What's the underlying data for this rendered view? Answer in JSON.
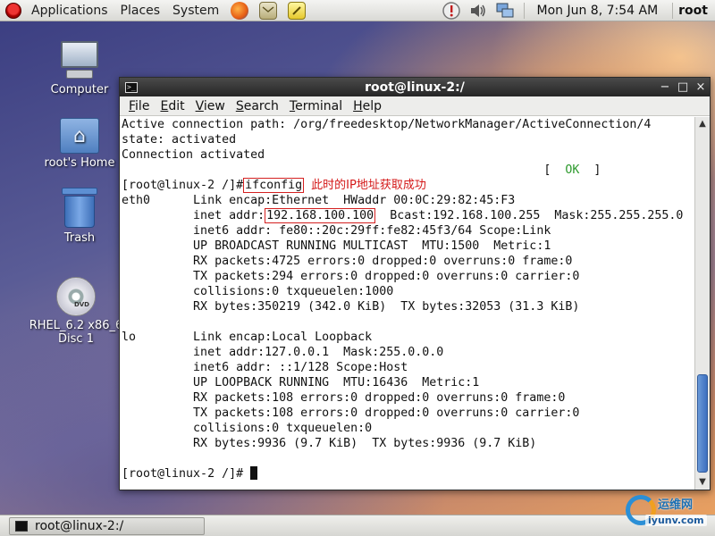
{
  "top_panel": {
    "menus": [
      "Applications",
      "Places",
      "System"
    ],
    "clock": "Mon Jun  8,  7:54 AM",
    "user": "root"
  },
  "desktop_icons": {
    "computer": "Computer",
    "home": "root's Home",
    "trash": "Trash",
    "dvd_line1": "RHEL_6.2 x86_6",
    "dvd_line2": "Disc 1",
    "dvd_badge": "DVD"
  },
  "window": {
    "title": "root@linux-2:/",
    "icon_text": ">_",
    "menus": [
      {
        "accel": "F",
        "rest": "ile"
      },
      {
        "accel": "E",
        "rest": "dit"
      },
      {
        "accel": "V",
        "rest": "iew"
      },
      {
        "accel": "S",
        "rest": "earch"
      },
      {
        "accel": "T",
        "rest": "erminal"
      },
      {
        "accel": "H",
        "rest": "elp"
      }
    ],
    "controls": [
      "−",
      "□",
      "×"
    ]
  },
  "terminal": {
    "line1": "Active connection path: /org/freedesktop/NetworkManager/ActiveConnection/4",
    "line2": "state: activated",
    "line3": "Connection activated",
    "ok_prefix": "                                                           [  ",
    "ok_word": "OK",
    "ok_suffix": "  ]",
    "prompt": "[root@linux-2 /]#",
    "command": "ifconfig",
    "annotation": "此时的IP地址获取成功",
    "eth0_line1": "eth0      Link encap:Ethernet  HWaddr 00:0C:29:82:45:F3",
    "eth0_addr_prefix": "          inet addr:",
    "eth0_ip": "192.168.100.100",
    "eth0_addr_suffix": "  Bcast:192.168.100.255  Mask:255.255.255.0",
    "eth0_rest": [
      "          inet6 addr: fe80::20c:29ff:fe82:45f3/64 Scope:Link",
      "          UP BROADCAST RUNNING MULTICAST  MTU:1500  Metric:1",
      "          RX packets:4725 errors:0 dropped:0 overruns:0 frame:0",
      "          TX packets:294 errors:0 dropped:0 overruns:0 carrier:0",
      "          collisions:0 txqueuelen:1000",
      "          RX bytes:350219 (342.0 KiB)  TX bytes:32053 (31.3 KiB)"
    ],
    "lo_lines": [
      "lo        Link encap:Local Loopback",
      "          inet addr:127.0.0.1  Mask:255.0.0.0",
      "          inet6 addr: ::1/128 Scope:Host",
      "          UP LOOPBACK RUNNING  MTU:16436  Metric:1",
      "          RX packets:108 errors:0 dropped:0 overruns:0 frame:0",
      "          TX packets:108 errors:0 dropped:0 overruns:0 carrier:0",
      "          collisions:0 txqueuelen:0",
      "          RX bytes:9936 (9.7 KiB)  TX bytes:9936 (9.7 KiB)"
    ],
    "final_prompt": "[root@linux-2 /]# "
  },
  "taskbar": {
    "task_label": "root@linux-2:/"
  },
  "watermark": {
    "cn": "运维网",
    "domain": "iyunv.com"
  },
  "colors": {
    "ok_green": "#2e9a2e",
    "annotation_red": "#d41818",
    "titlebar": "#2f2f2f"
  },
  "icons": [
    "redhat-icon",
    "firefox-icon",
    "mail-icon",
    "notes-icon",
    "update-icon",
    "volume-icon",
    "network-icon",
    "terminal-icon"
  ]
}
